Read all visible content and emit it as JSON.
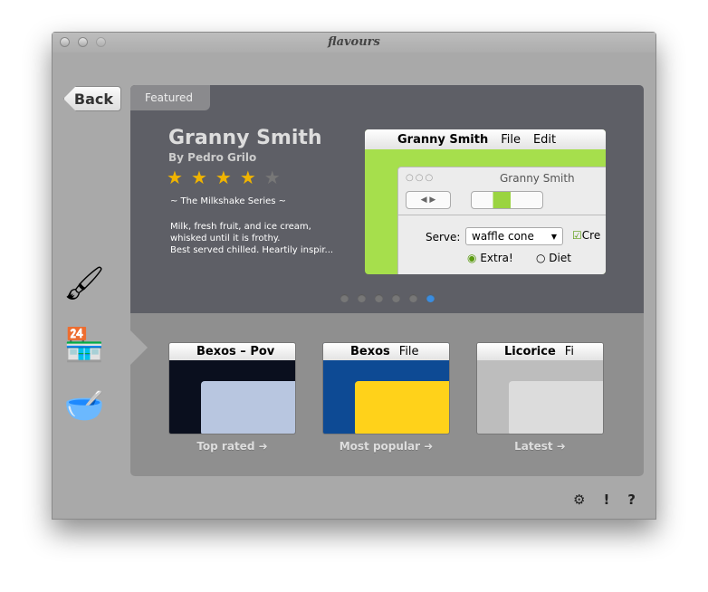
{
  "window": {
    "title": "flavours"
  },
  "nav": {
    "back_label": "Back",
    "sidebar": [
      {
        "icon": "paint-brush-icon"
      },
      {
        "icon": "store-icon"
      },
      {
        "icon": "mixing-bowl-icon"
      }
    ]
  },
  "featured": {
    "tab_label": "Featured",
    "title": "Granny Smith",
    "author": "By Pedro Grilo",
    "rating": 4,
    "rating_max": 5,
    "series": "~ The Milkshake Series ~",
    "description": [
      "Milk, fresh fruit, and ice cream,",
      "whisked until it is frothy.",
      "Best served chilled. Heartily inspir..."
    ],
    "preview": {
      "menu": [
        "Granny Smith",
        "File",
        "Edit"
      ],
      "window_title": "Granny Smith",
      "serve_label": "Serve:",
      "serve_value": "waffle cone",
      "checkbox_label": "Cre",
      "radio_extra": "Extra!",
      "radio_diet": "Diet"
    },
    "page_count": 6,
    "current_page": 6
  },
  "categories": [
    {
      "label": "Top rated ➜",
      "theme": "Bexos – Pov",
      "accent": "#b8c6e0",
      "bg": "#0a0f1e"
    },
    {
      "label": "Most popular ➜",
      "theme": "Bexos",
      "menu2": "File",
      "accent": "#ffd21a",
      "bg": "#0d4a94"
    },
    {
      "label": "Latest ➜",
      "theme": "Licorice",
      "menu2": "Fi",
      "accent": "#dcdcdc",
      "bg": "#bdbdbd"
    }
  ],
  "footer": {
    "settings": "⚙",
    "alert": "!",
    "help": "?"
  }
}
